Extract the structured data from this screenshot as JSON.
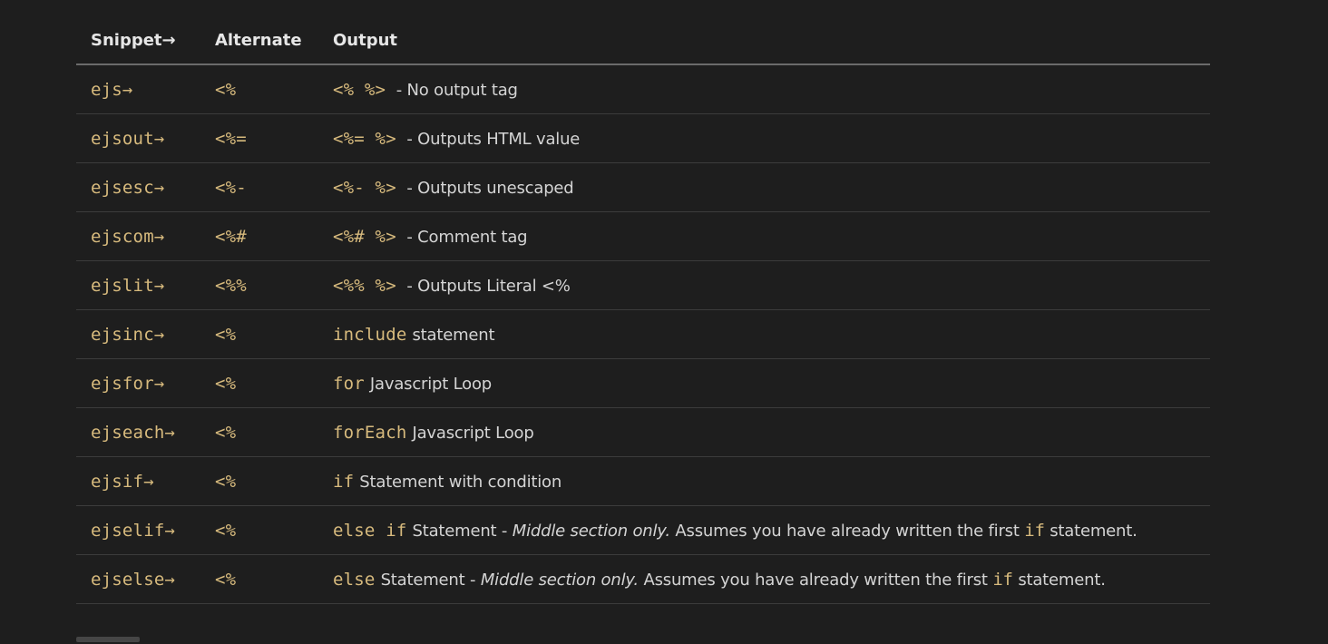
{
  "table": {
    "headers": [
      "Snippet→",
      "Alternate",
      "Output"
    ],
    "rows": [
      {
        "snippet": "ejs→",
        "alternate": "<%",
        "output_code": "<% %>",
        "output_text": " - No output tag"
      },
      {
        "snippet": "ejsout→",
        "alternate": "<%=",
        "output_code": "<%= %>",
        "output_text": " - Outputs HTML value"
      },
      {
        "snippet": "ejsesc→",
        "alternate": "<%-",
        "output_code": "<%- %>",
        "output_text": " - Outputs unescaped"
      },
      {
        "snippet": "ejscom→",
        "alternate": "<%#",
        "output_code": "<%# %>",
        "output_text": " - Comment tag"
      },
      {
        "snippet": "ejslit→",
        "alternate": "<%%",
        "output_code": "<%% %>",
        "output_text": " - Outputs Literal <%"
      },
      {
        "snippet": "ejsinc→",
        "alternate": "<%",
        "output_code": "include",
        "output_text": "statement"
      },
      {
        "snippet": "ejsfor→",
        "alternate": "<%",
        "output_code": "for",
        "output_text": "Javascript Loop"
      },
      {
        "snippet": "ejseach→",
        "alternate": "<%",
        "output_code": "forEach",
        "output_text": "Javascript Loop"
      },
      {
        "snippet": "ejsif→",
        "alternate": "<%",
        "output_code": "if",
        "output_text": "Statement with condition"
      },
      {
        "snippet": "ejselif→",
        "alternate": "<%",
        "output_code": "else if",
        "output_text": "Statement - ",
        "output_em": "Middle section only.",
        "output_after": " Assumes you have already written the first ",
        "output_code2": "if",
        "output_tail": " statement."
      },
      {
        "snippet": "ejselse→",
        "alternate": "<%",
        "output_code": "else",
        "output_text": "Statement - ",
        "output_em": "Middle section only.",
        "output_after": " Assumes you have already written the first ",
        "output_code2": "if",
        "output_tail": " statement."
      }
    ]
  },
  "colors": {
    "background": "#1e1e1e",
    "code": "#d7ba7d",
    "text": "#d4d4d4",
    "header": "#e6e6e6"
  }
}
